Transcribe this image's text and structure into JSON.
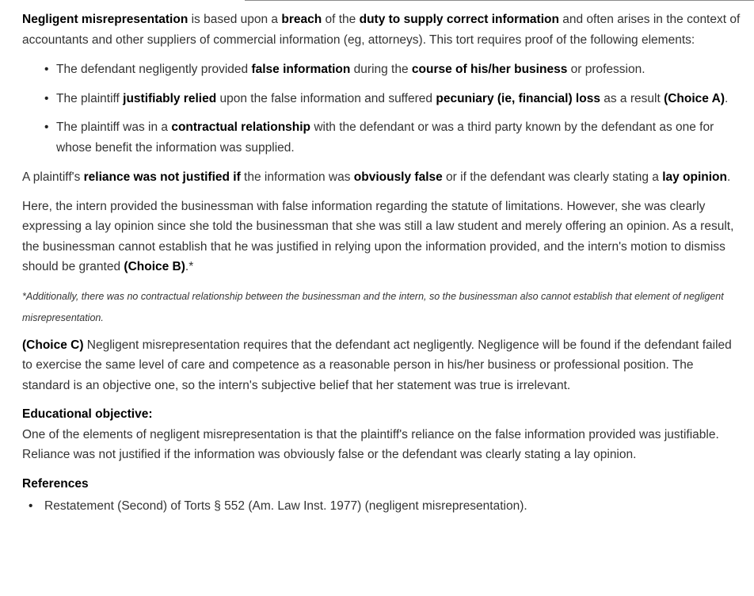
{
  "intro": {
    "t1": "Negligent misrepresentation",
    "t2": " is based upon a ",
    "t3": "breach",
    "t4": " of the ",
    "t5": "duty to supply correct information",
    "t6": " and often arises in the context of accountants and other suppliers of commercial information (eg, attorneys).  This tort requires proof of the following elements:"
  },
  "elements": [
    {
      "a": "The defendant negligently provided ",
      "b": "false information",
      "c": " during the ",
      "d": "course of his/her business",
      "e": " or profession."
    },
    {
      "a": "The plaintiff ",
      "b": "justifiably relied",
      "c": " upon the false information and suffered ",
      "d": "pecuniary (ie, financial) loss",
      "e": " as a result ",
      "f": "(Choice A)",
      "g": "."
    },
    {
      "a": "The plaintiff was in a ",
      "b": "contractual relationship",
      "c": " with the defendant or was a third party known by the defendant as one for whose benefit the information was supplied."
    }
  ],
  "reliance": {
    "t1": "A plaintiff's ",
    "t2": "reliance was not justified if",
    "t3": " the information was ",
    "t4": "obviously false",
    "t5": " or if the defendant was clearly stating a ",
    "t6": "lay opinion",
    "t7": "."
  },
  "here": {
    "t1": "Here, the intern provided the businessman with false information regarding the statute of limitations.  However, she was clearly expressing a lay opinion since she told the businessman that she was still a law student and merely offering an opinion.  As a result, the businessman cannot establish that he was justified in relying upon the information provided, and the intern's motion to dismiss should be granted ",
    "t2": "(Choice B)",
    "t3": ".*"
  },
  "note": "*Additionally, there was no contractual relationship between the businessman and the intern, so the businessman also cannot establish that element of negligent misrepresentation.",
  "choice_c": {
    "label": "(Choice C)",
    "text": "  Negligent misrepresentation requires that the defendant act negligently.  Negligence will be found if the defendant failed to exercise the same level of care and competence as a reasonable person in his/her business or professional position.  The standard is an objective one, so the intern's subjective belief that her statement was true is irrelevant."
  },
  "objective": {
    "title": "Educational objective:",
    "text": "One of the elements of negligent misrepresentation is that the plaintiff's reliance on the false information provided was justifiable.  Reliance was not justified if the information was obviously false or the defendant was clearly stating a lay opinion."
  },
  "references": {
    "title": "References",
    "items": [
      "Restatement (Second) of Torts § 552 (Am. Law Inst. 1977) (negligent misrepresentation)."
    ]
  }
}
